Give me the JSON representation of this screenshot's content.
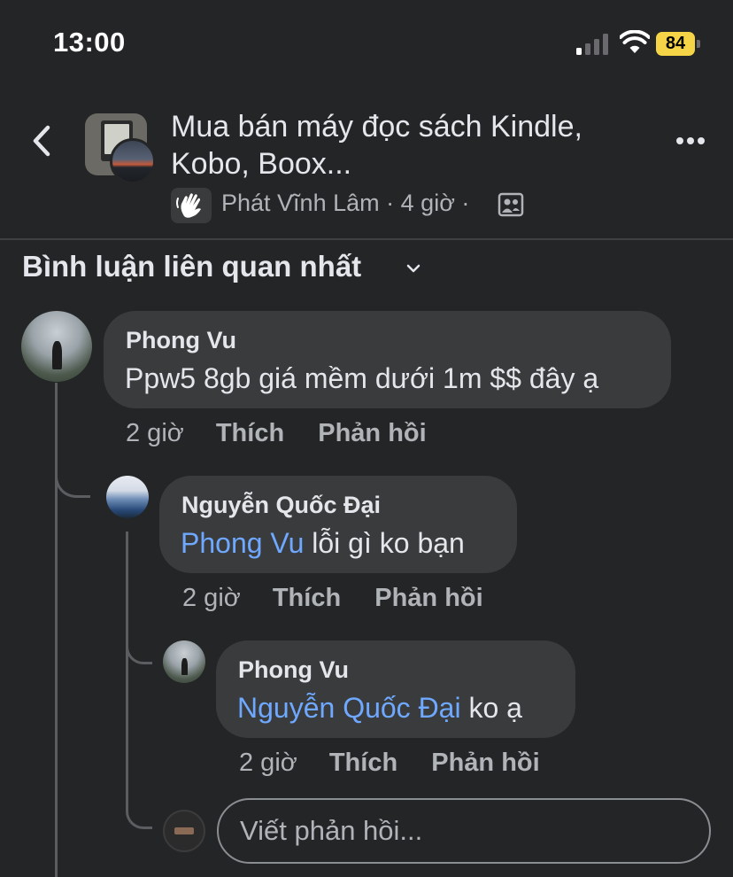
{
  "status_bar": {
    "time": "13:00",
    "battery": "84"
  },
  "header": {
    "title": "Mua bán máy đọc sách Kindle, Kobo, Boox...",
    "author": "Phát Vĩnh Lâm",
    "time": "4 giờ",
    "separator": "·"
  },
  "sort": {
    "label": "Bình luận liên quan nhất"
  },
  "comments": [
    {
      "author": "Phong Vu",
      "mention": "",
      "text": "Ppw5 8gb giá mềm dưới 1m $$ đây ạ",
      "time": "2 giờ",
      "like": "Thích",
      "reply": "Phản hồi"
    },
    {
      "author": "Nguyễn Quốc Đại",
      "mention": "Phong Vu",
      "text": "lỗi gì ko bạn",
      "time": "2 giờ",
      "like": "Thích",
      "reply": "Phản hồi"
    },
    {
      "author": "Phong Vu",
      "mention": "Nguyễn Quốc Đại",
      "text": "ko ạ",
      "time": "2 giờ",
      "like": "Thích",
      "reply": "Phản hồi"
    }
  ],
  "reply_box": {
    "placeholder": "Viết phản hồi..."
  },
  "icons": {
    "back": "chevron-left-icon",
    "more": "more-horizontal-icon",
    "badge": "waving-hand-icon",
    "privacy": "members-only-icon",
    "sort": "chevron-down-icon",
    "signal": "cellular-signal-icon",
    "wifi": "wifi-icon",
    "battery": "battery-icon"
  },
  "colors": {
    "background": "#242526",
    "bubble": "#3a3b3c",
    "mention": "#6fa8ff",
    "secondary_text": "#b0b3b8",
    "battery": "#f5d547"
  }
}
